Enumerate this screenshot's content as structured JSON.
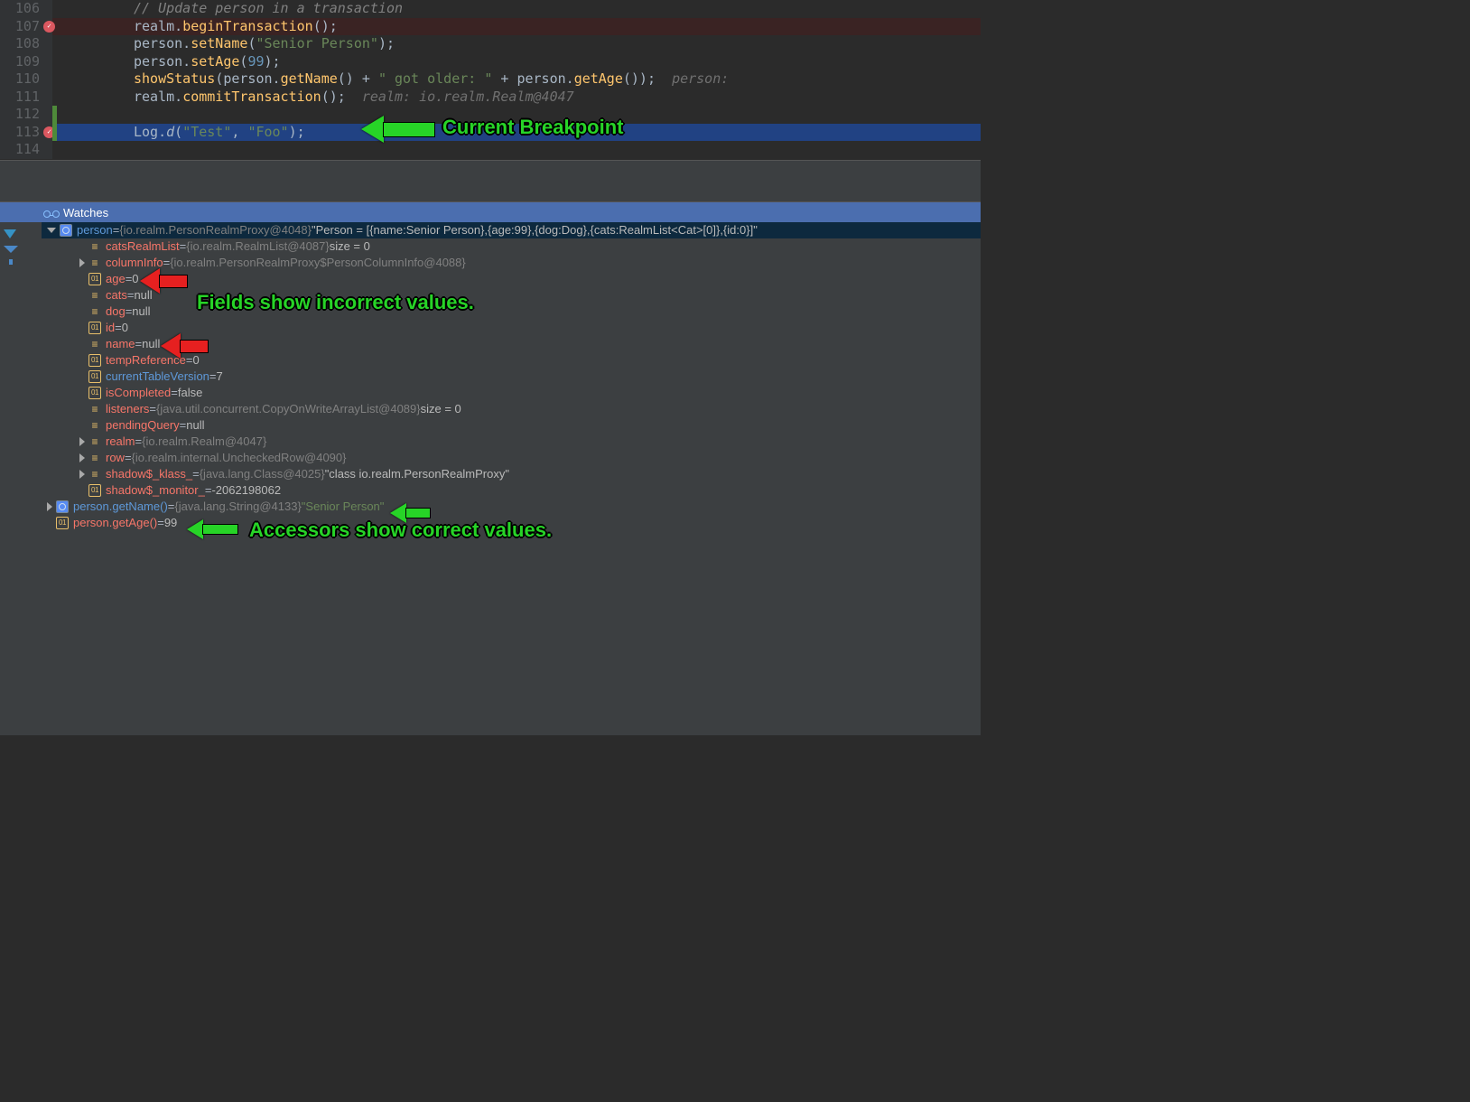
{
  "editor": {
    "lines": [
      {
        "num": "106",
        "bp": false,
        "exec": false,
        "greenbar": false,
        "tokens": [
          {
            "c": "c-comment",
            "t": "// Update person in a transaction"
          }
        ]
      },
      {
        "num": "107",
        "bp": true,
        "exec": false,
        "greenbar": false,
        "tokens": [
          {
            "c": "c-ident",
            "t": "realm."
          },
          {
            "c": "c-call",
            "t": "beginTransaction"
          },
          {
            "c": "c-ident",
            "t": "();"
          }
        ]
      },
      {
        "num": "108",
        "bp": false,
        "exec": false,
        "greenbar": false,
        "tokens": [
          {
            "c": "c-ident",
            "t": "person."
          },
          {
            "c": "c-call",
            "t": "setName"
          },
          {
            "c": "c-ident",
            "t": "("
          },
          {
            "c": "c-string",
            "t": "\"Senior Person\""
          },
          {
            "c": "c-ident",
            "t": ");"
          }
        ]
      },
      {
        "num": "109",
        "bp": false,
        "exec": false,
        "greenbar": false,
        "tokens": [
          {
            "c": "c-ident",
            "t": "person."
          },
          {
            "c": "c-call",
            "t": "setAge"
          },
          {
            "c": "c-ident",
            "t": "("
          },
          {
            "c": "c-num",
            "t": "99"
          },
          {
            "c": "c-ident",
            "t": ");"
          }
        ]
      },
      {
        "num": "110",
        "bp": false,
        "exec": false,
        "greenbar": false,
        "tokens": [
          {
            "c": "c-call",
            "t": "showStatus"
          },
          {
            "c": "c-ident",
            "t": "(person."
          },
          {
            "c": "c-call",
            "t": "getName"
          },
          {
            "c": "c-ident",
            "t": "() + "
          },
          {
            "c": "c-string",
            "t": "\" got older: \""
          },
          {
            "c": "c-ident",
            "t": " + person."
          },
          {
            "c": "c-call",
            "t": "getAge"
          },
          {
            "c": "c-ident",
            "t": "());  "
          },
          {
            "c": "c-hint",
            "t": "person:"
          }
        ]
      },
      {
        "num": "111",
        "bp": false,
        "exec": false,
        "greenbar": false,
        "tokens": [
          {
            "c": "c-ident",
            "t": "realm."
          },
          {
            "c": "c-call",
            "t": "commitTransaction"
          },
          {
            "c": "c-ident",
            "t": "();  "
          },
          {
            "c": "c-hint",
            "t": "realm: io.realm.Realm@4047"
          }
        ]
      },
      {
        "num": "112",
        "bp": false,
        "exec": false,
        "greenbar": true,
        "tokens": []
      },
      {
        "num": "113",
        "bp": true,
        "exec": true,
        "greenbar": true,
        "tokens": [
          {
            "c": "c-ident",
            "t": "Log."
          },
          {
            "c": "c-static",
            "t": "d"
          },
          {
            "c": "c-ident",
            "t": "("
          },
          {
            "c": "c-string",
            "t": "\"Test\""
          },
          {
            "c": "c-ident",
            "t": ", "
          },
          {
            "c": "c-string",
            "t": "\"Foo\""
          },
          {
            "c": "c-ident",
            "t": ");"
          }
        ]
      },
      {
        "num": "114",
        "bp": false,
        "exec": false,
        "greenbar": false,
        "tokens": []
      }
    ]
  },
  "watches": {
    "header": "Watches",
    "rows": [
      {
        "sel": true,
        "ind": 0,
        "disc": "open",
        "icon": "obj",
        "name": "person",
        "nameCls": "fld2",
        "eq": " = ",
        "tail": [
          {
            "c": "val-grey",
            "t": "{io.realm.PersonRealmProxy@4048}"
          },
          {
            "c": "val-light",
            "t": " \"Person = [{name:Senior Person},{age:99},{dog:Dog},{cats:RealmList<Cat>[0]},{id:0}]\""
          }
        ]
      },
      {
        "sel": false,
        "ind": 1,
        "disc": "none",
        "icon": "bars",
        "name": "catsRealmList",
        "nameCls": "fld",
        "eq": " = ",
        "tail": [
          {
            "c": "val-grey",
            "t": "{io.realm.RealmList@4087}"
          },
          {
            "c": "val-light",
            "t": "  size = 0"
          }
        ]
      },
      {
        "sel": false,
        "ind": 1,
        "disc": "closed",
        "icon": "bars",
        "name": "columnInfo",
        "nameCls": "fld",
        "eq": " = ",
        "tail": [
          {
            "c": "val-grey",
            "t": "{io.realm.PersonRealmProxy$PersonColumnInfo@4088}"
          }
        ]
      },
      {
        "sel": false,
        "ind": 1,
        "disc": "none",
        "icon": "prim",
        "name": "age",
        "nameCls": "fld",
        "eq": " = ",
        "tail": [
          {
            "c": "val-light",
            "t": "0"
          }
        ]
      },
      {
        "sel": false,
        "ind": 1,
        "disc": "none",
        "icon": "bars",
        "name": "cats",
        "nameCls": "fld",
        "eq": " = ",
        "tail": [
          {
            "c": "val-light",
            "t": "null"
          }
        ]
      },
      {
        "sel": false,
        "ind": 1,
        "disc": "none",
        "icon": "bars",
        "name": "dog",
        "nameCls": "fld",
        "eq": " = ",
        "tail": [
          {
            "c": "val-light",
            "t": "null"
          }
        ]
      },
      {
        "sel": false,
        "ind": 1,
        "disc": "none",
        "icon": "prim",
        "name": "id",
        "nameCls": "fld",
        "eq": " = ",
        "tail": [
          {
            "c": "val-light",
            "t": "0"
          }
        ]
      },
      {
        "sel": false,
        "ind": 1,
        "disc": "none",
        "icon": "bars",
        "name": "name",
        "nameCls": "fld",
        "eq": " = ",
        "tail": [
          {
            "c": "val-light",
            "t": "null"
          }
        ]
      },
      {
        "sel": false,
        "ind": 1,
        "disc": "none",
        "icon": "prim",
        "name": "tempReference",
        "nameCls": "fld",
        "eq": " = ",
        "tail": [
          {
            "c": "val-light",
            "t": "0"
          }
        ]
      },
      {
        "sel": false,
        "ind": 1,
        "disc": "none",
        "icon": "prim",
        "name": "currentTableVersion",
        "nameCls": "fld2",
        "eq": " = ",
        "tail": [
          {
            "c": "val-light",
            "t": "7"
          }
        ]
      },
      {
        "sel": false,
        "ind": 1,
        "disc": "none",
        "icon": "prim",
        "name": "isCompleted",
        "nameCls": "fld",
        "eq": " = ",
        "tail": [
          {
            "c": "val-light",
            "t": "false"
          }
        ]
      },
      {
        "sel": false,
        "ind": 1,
        "disc": "none",
        "icon": "bars",
        "name": "listeners",
        "nameCls": "fld",
        "eq": " = ",
        "tail": [
          {
            "c": "val-grey",
            "t": "{java.util.concurrent.CopyOnWriteArrayList@4089}"
          },
          {
            "c": "val-light",
            "t": "  size = 0"
          }
        ]
      },
      {
        "sel": false,
        "ind": 1,
        "disc": "none",
        "icon": "bars",
        "name": "pendingQuery",
        "nameCls": "fld",
        "eq": " = ",
        "tail": [
          {
            "c": "val-light",
            "t": "null"
          }
        ]
      },
      {
        "sel": false,
        "ind": 1,
        "disc": "closed",
        "icon": "bars",
        "name": "realm",
        "nameCls": "fld",
        "eq": " = ",
        "tail": [
          {
            "c": "val-grey",
            "t": "{io.realm.Realm@4047}"
          }
        ]
      },
      {
        "sel": false,
        "ind": 1,
        "disc": "closed",
        "icon": "bars",
        "name": "row",
        "nameCls": "fld",
        "eq": " = ",
        "tail": [
          {
            "c": "val-grey",
            "t": "{io.realm.internal.UncheckedRow@4090}"
          }
        ]
      },
      {
        "sel": false,
        "ind": 1,
        "disc": "closed",
        "icon": "bars",
        "name": "shadow$_klass_",
        "nameCls": "fld",
        "eq": " = ",
        "tail": [
          {
            "c": "val-grey",
            "t": "{java.lang.Class@4025}"
          },
          {
            "c": "val-light",
            "t": " \"class io.realm.PersonRealmProxy\""
          }
        ]
      },
      {
        "sel": false,
        "ind": 1,
        "disc": "none",
        "icon": "prim",
        "name": "shadow$_monitor_",
        "nameCls": "fld",
        "eq": " = ",
        "tail": [
          {
            "c": "val-light",
            "t": "-2062198062"
          }
        ]
      },
      {
        "sel": false,
        "ind": 0,
        "disc": "closed",
        "icon": "obj",
        "name": "person.getName()",
        "nameCls": "fld2",
        "eq": " = ",
        "tail": [
          {
            "c": "val-grey",
            "t": "{java.lang.String@4133}"
          },
          {
            "c": "val-str",
            "t": " \"Senior Person\""
          }
        ]
      },
      {
        "sel": false,
        "ind": 0,
        "disc": "none",
        "icon": "prim",
        "name": "person.getAge()",
        "nameCls": "fld",
        "eq": " = ",
        "tail": [
          {
            "c": "val-light",
            "t": "99"
          }
        ]
      }
    ]
  },
  "annotations": {
    "a1": "Current Breakpoint",
    "a2": "Fields show incorrect values.",
    "a3": "Accessors show correct values."
  }
}
